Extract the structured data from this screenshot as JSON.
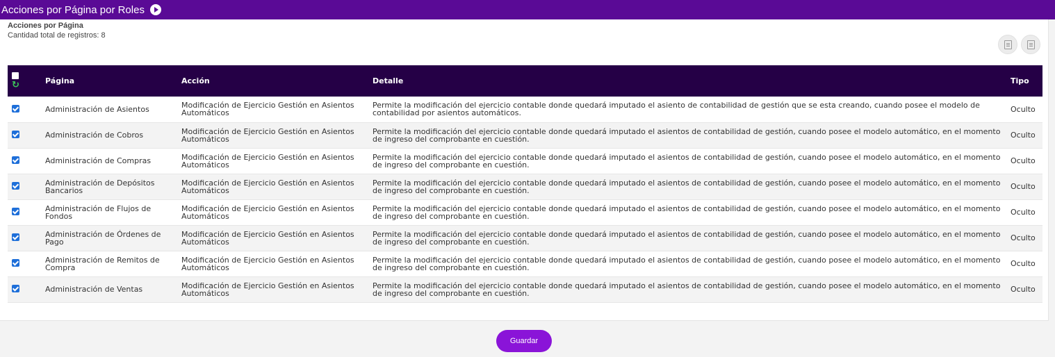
{
  "header": {
    "title": "Acciones por Página por Roles"
  },
  "panel": {
    "subtitle": "Acciones por Página",
    "count": "Cantidad total de registros: 8"
  },
  "toolbar": {
    "export_excel_icon": "excel-icon",
    "export_csv_icon": "csv-icon"
  },
  "table": {
    "columns": {
      "pagina": "Página",
      "accion": "Acción",
      "detalle": "Detalle",
      "tipo": "Tipo"
    },
    "rows": [
      {
        "pagina": "Administración de Asientos",
        "accion": "Modificación de Ejercicio Gestión en Asientos Automáticos",
        "detalle": "Permite la modificación del ejercicio contable donde quedará imputado el asiento de contabilidad de gestión que se esta creando, cuando posee el modelo de contabilidad por asientos automáticos.",
        "tipo": "Oculto"
      },
      {
        "pagina": "Administración de Cobros",
        "accion": "Modificación de Ejercicio Gestión en Asientos Automáticos",
        "detalle": "Permite la modificación del ejercicio contable donde quedará imputado el asientos de contabilidad de gestión, cuando posee el modelo automático, en el momento de ingreso del comprobante en cuestión.",
        "tipo": "Oculto"
      },
      {
        "pagina": "Administración de Compras",
        "accion": "Modificación de Ejercicio Gestión en Asientos Automáticos",
        "detalle": "Permite la modificación del ejercicio contable donde quedará imputado el asientos de contabilidad de gestión, cuando posee el modelo automático, en el momento de ingreso del comprobante en cuestión.",
        "tipo": "Oculto"
      },
      {
        "pagina": "Administración de Depósitos Bancarios",
        "accion": "Modificación de Ejercicio Gestión en Asientos Automáticos",
        "detalle": "Permite la modificación del ejercicio contable donde quedará imputado el asientos de contabilidad de gestión, cuando posee el modelo automático, en el momento de ingreso del comprobante en cuestión.",
        "tipo": "Oculto"
      },
      {
        "pagina": "Administración de Flujos de Fondos",
        "accion": "Modificación de Ejercicio Gestión en Asientos Automáticos",
        "detalle": "Permite la modificación del ejercicio contable donde quedará imputado el asientos de contabilidad de gestión, cuando posee el modelo automático, en el momento de ingreso del comprobante en cuestión.",
        "tipo": "Oculto"
      },
      {
        "pagina": "Administración de Órdenes de Pago",
        "accion": "Modificación de Ejercicio Gestión en Asientos Automáticos",
        "detalle": "Permite la modificación del ejercicio contable donde quedará imputado el asientos de contabilidad de gestión, cuando posee el modelo automático, en el momento de ingreso del comprobante en cuestión.",
        "tipo": "Oculto"
      },
      {
        "pagina": "Administración de Remitos de Compra",
        "accion": "Modificación de Ejercicio Gestión en Asientos Automáticos",
        "detalle": "Permite la modificación del ejercicio contable donde quedará imputado el asientos de contabilidad de gestión, cuando posee el modelo automático, en el momento de ingreso del comprobante en cuestión.",
        "tipo": "Oculto"
      },
      {
        "pagina": "Administración de Ventas",
        "accion": "Modificación de Ejercicio Gestión en Asientos Automáticos",
        "detalle": "Permite la modificación del ejercicio contable donde quedará imputado el asientos de contabilidad de gestión, cuando posee el modelo automático, en el momento de ingreso del comprobante en cuestión.",
        "tipo": "Oculto"
      }
    ]
  },
  "footer": {
    "save_label": "Guardar"
  },
  "colors": {
    "header_bar": "#5a0a96",
    "table_header": "#250046",
    "save_button": "#8a14d8",
    "checkbox": "#1e6fd9",
    "refresh": "#3cc85a"
  }
}
